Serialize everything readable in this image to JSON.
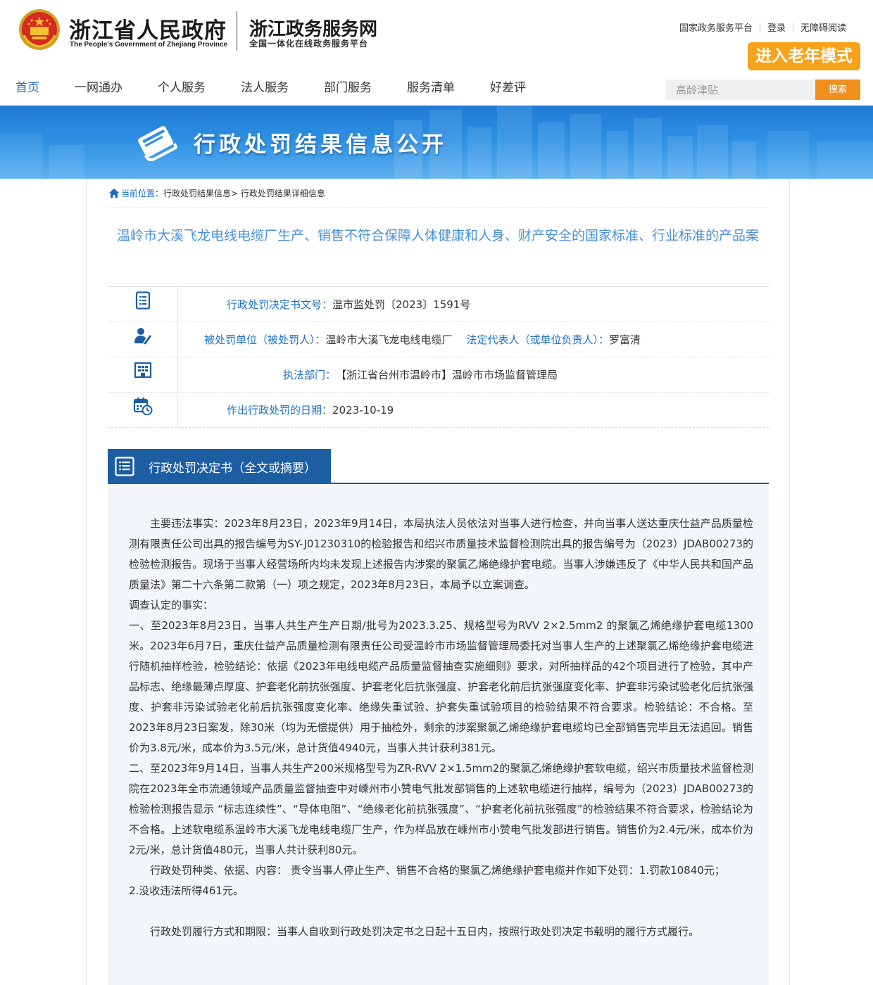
{
  "header": {
    "gov_name": "浙江省人民政府",
    "gov_name_en": "The People's Government of Zhejiang Province",
    "site_name": "浙江政务服务网",
    "site_sub": "全国一体化在线政务服务平台",
    "top_links": [
      "国家政务服务平台",
      "登录",
      "无障碍阅读"
    ],
    "elder_mode": "进入老年模式",
    "nav": [
      "首页",
      "一网通办",
      "个人服务",
      "法人服务",
      "部门服务",
      "服务清单",
      "好差评"
    ],
    "search": {
      "placeholder": "高龄津贴",
      "button": "搜索"
    }
  },
  "banner": {
    "title": "行政处罚结果信息公开"
  },
  "breadcrumb": {
    "current": "当前位置",
    "items": [
      "行政处罚结果信息",
      "行政处罚结果详细信息"
    ]
  },
  "case": {
    "title": "温岭市大溪飞龙电线电缆厂生产、销售不符合保障人体健康和人身、财产安全的国家标准、行业标准的产品案",
    "doc_no_label": "行政处罚决定书文号：",
    "doc_no": "温市监处罚〔2023〕1591号",
    "party_label": "被处罚单位（被处罚人）：",
    "party": "温岭市大溪飞龙电线电缆厂",
    "rep_label": "法定代表人（或单位负责人）：",
    "rep": "罗富清",
    "dept_label": "执法部门：",
    "dept": "【浙江省台州市温岭市】温岭市市场监督管理局",
    "date_label": "作出行政处罚的日期：",
    "date": "2023-10-19"
  },
  "decision": {
    "heading": "行政处罚决定书（全文或摘要）",
    "p1": "主要违法事实：2023年8月23日，2023年9月14日，本局执法人员依法对当事人进行检查，并向当事人送达重庆仕益产品质量检测有限责任公司出具的报告编号为SY-J01230310的检验报告和绍兴市质量技术监督检测院出具的报告编号为（2023）JDAB00273的检验检测报告。现场于当事人经营场所内均未发现上述报告内涉案的聚氯乙烯绝缘护套电缆。当事人涉嫌违反了《中华人民共和国产品质量法》第二十六条第二款第（一）项之规定，2023年8月23日，本局予以立案调查。",
    "p2": "调查认定的事实：",
    "p3": "一、至2023年8月23日，当事人共生产生产日期/批号为2023.3.25、规格型号为RVV 2×2.5mm2 的聚氯乙烯绝缘护套电缆1300米。2023年6月7日，重庆仕益产品质量检测有限责任公司受温岭市市场监督管理局委托对当事人生产的上述聚氯乙烯绝缘护套电缆进行随机抽样检验，检验结论：依据《2023年电线电缆产品质量监督抽查实施细则》要求，对所抽样品的42个项目进行了检验，其中产品标志、绝缘最薄点厚度、护套老化前抗张强度、护套老化后抗张强度、护套老化前后抗张强度变化率、护套非污染试验老化后抗张强度、护套非污染试验老化前后抗张强度变化率、绝缘失重试验、护套失重试验项目的检验结果不符合要求。检验结论：不合格。至2023年8月23日案发，除30米（均为无偿提供）用于抽检外，剩余的涉案聚氯乙烯绝缘护套电缆均已全部销售完毕且无法追回。销售价为3.8元/米，成本价为3.5元/米，总计货值4940元，当事人共计获利381元。",
    "p4": "二、至2023年9月14日，当事人共生产200米规格型号为ZR-RVV 2×1.5mm2的聚氯乙烯绝缘护套软电缆，绍兴市质量技术监督检测院在2023年全市流通领域产品质量监督抽查中对嵊州市小赞电气批发部销售的上述软电缆进行抽样，编号为（2023）JDAB00273的检验检测报告显示 “标志连续性”、“导体电阻”、“绝缘老化前抗张强度”、“护套老化前抗张强度”的检验结果不符合要求，检验结论为不合格。上述软电缆系温岭市大溪飞龙电线电缆厂生产，作为样品放在嵊州市小赞电气批发部进行销售。销售价为2.4元/米，成本价为2元/米，总计货值480元，当事人共计获利80元。",
    "p5": "行政处罚种类、依据、内容： 责令当事人停止生产、销售不合格的聚氯乙烯绝缘护套电缆并作如下处罚：1.罚款10840元；",
    "p6": "2.没收违法所得461元。",
    "p7": "行政处罚履行方式和期限：当事人自收到行政处罚决定书之日起十五日内，按照行政处罚决定书载明的履行方式履行。"
  },
  "colors": {
    "accent": "#1a6fc4",
    "elder": "#f7a21b",
    "search_btn": "#f18f1c",
    "section": "#1d5ea3"
  }
}
